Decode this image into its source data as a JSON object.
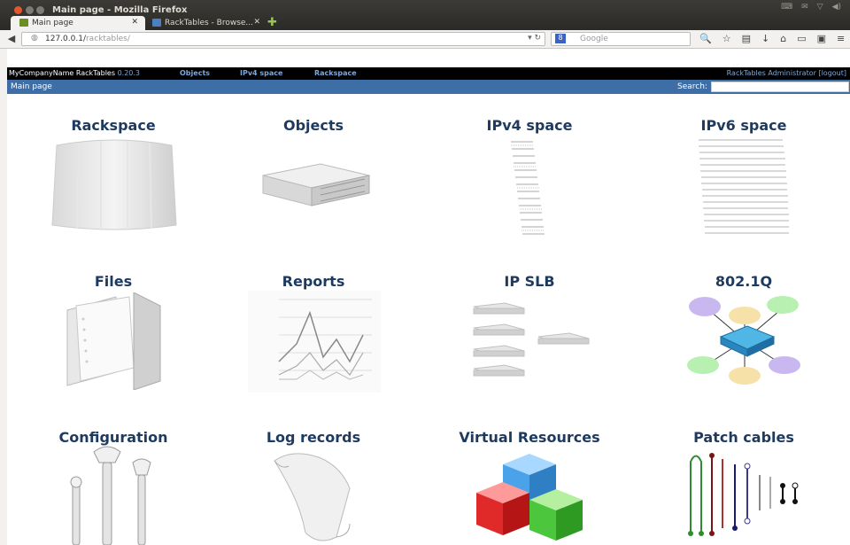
{
  "window": {
    "title": "Main page - Mozilla Firefox"
  },
  "tabs": [
    {
      "label": "Main page",
      "active": true
    },
    {
      "label": "RackTables - Browse...",
      "active": false
    }
  ],
  "browser": {
    "url_host": "127.0.0.1/",
    "url_path": "racktables/",
    "search_placeholder": "Google"
  },
  "app": {
    "brand": "MyCompanyName RackTables",
    "version": "0.20.3",
    "nav": [
      "Objects",
      "IPv4 space",
      "Rackspace"
    ],
    "user": "RackTables Administrator",
    "logout": "logout",
    "breadcrumb": "Main page",
    "search_label": "Search:"
  },
  "tiles": [
    {
      "label": "Rackspace",
      "icon": "rackspace-icon"
    },
    {
      "label": "Objects",
      "icon": "server-icon"
    },
    {
      "label": "IPv4 space",
      "icon": "ipv4-list-icon"
    },
    {
      "label": "IPv6 space",
      "icon": "ipv6-list-icon"
    },
    {
      "label": "Files",
      "icon": "folder-icon"
    },
    {
      "label": "Reports",
      "icon": "chart-icon"
    },
    {
      "label": "IP SLB",
      "icon": "load-balancer-icon"
    },
    {
      "label": "802.1Q",
      "icon": "vlan-switch-icon"
    },
    {
      "label": "Configuration",
      "icon": "wrench-icon"
    },
    {
      "label": "Log records",
      "icon": "scroll-icon"
    },
    {
      "label": "Virtual Resources",
      "icon": "cubes-icon"
    },
    {
      "label": "Patch cables",
      "icon": "cables-icon"
    }
  ]
}
